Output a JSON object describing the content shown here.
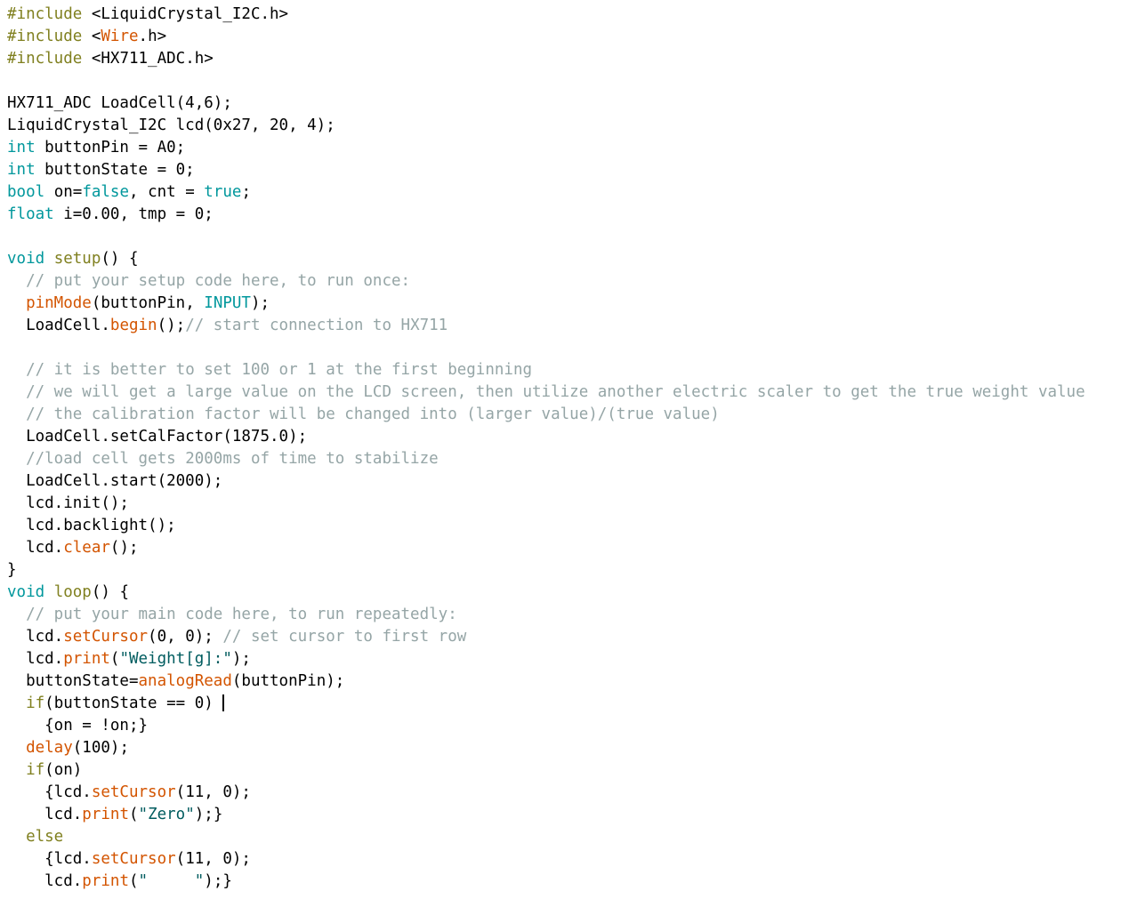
{
  "editor": {
    "language": "arduino-cpp",
    "background_color": "#ffffff",
    "font_size_px": 17.5,
    "line_height_px": 25,
    "caret_visible": true,
    "caret_line_index": 35,
    "colors": {
      "plain": "#000000",
      "keyword": "#00979c",
      "preprocessor": "#808020",
      "function": "#d35400",
      "comment": "#95a5a6",
      "string": "#005c5f"
    }
  },
  "code": {
    "lines": [
      {
        "id": "l1",
        "tokens": [
          {
            "t": "#include",
            "c": "preproc"
          },
          {
            "t": " <LiquidCrystal_I2C.h>",
            "c": "plain"
          }
        ]
      },
      {
        "id": "l2",
        "tokens": [
          {
            "t": "#include",
            "c": "preproc"
          },
          {
            "t": " <",
            "c": "plain"
          },
          {
            "t": "Wire",
            "c": "func"
          },
          {
            "t": ".h>",
            "c": "plain"
          }
        ]
      },
      {
        "id": "l3",
        "tokens": [
          {
            "t": "#include",
            "c": "preproc"
          },
          {
            "t": " <HX711_ADC.h>",
            "c": "plain"
          }
        ]
      },
      {
        "id": "l4",
        "tokens": []
      },
      {
        "id": "l5",
        "tokens": [
          {
            "t": "HX711_ADC LoadCell(4,6);",
            "c": "plain"
          }
        ]
      },
      {
        "id": "l6",
        "tokens": [
          {
            "t": "LiquidCrystal_I2C lcd(0x27, 20, 4);",
            "c": "plain"
          }
        ]
      },
      {
        "id": "l7",
        "tokens": [
          {
            "t": "int",
            "c": "keyword"
          },
          {
            "t": " buttonPin = A0;",
            "c": "plain"
          }
        ]
      },
      {
        "id": "l8",
        "tokens": [
          {
            "t": "int",
            "c": "keyword"
          },
          {
            "t": " buttonState = 0;",
            "c": "plain"
          }
        ]
      },
      {
        "id": "l9",
        "tokens": [
          {
            "t": "bool",
            "c": "keyword"
          },
          {
            "t": " on=",
            "c": "plain"
          },
          {
            "t": "false",
            "c": "keyword"
          },
          {
            "t": ", cnt = ",
            "c": "plain"
          },
          {
            "t": "true",
            "c": "keyword"
          },
          {
            "t": ";",
            "c": "plain"
          }
        ]
      },
      {
        "id": "l10",
        "tokens": [
          {
            "t": "float",
            "c": "keyword"
          },
          {
            "t": " i=0.00, tmp = 0;",
            "c": "plain"
          }
        ]
      },
      {
        "id": "l11",
        "tokens": []
      },
      {
        "id": "l12",
        "tokens": [
          {
            "t": "void",
            "c": "keyword"
          },
          {
            "t": " ",
            "c": "plain"
          },
          {
            "t": "setup",
            "c": "preproc"
          },
          {
            "t": "() {",
            "c": "plain"
          }
        ]
      },
      {
        "id": "l13",
        "tokens": [
          {
            "t": "  ",
            "c": "plain"
          },
          {
            "t": "// put your setup code here, to run once:",
            "c": "comment"
          }
        ]
      },
      {
        "id": "l14",
        "tokens": [
          {
            "t": "  ",
            "c": "plain"
          },
          {
            "t": "pinMode",
            "c": "func"
          },
          {
            "t": "(buttonPin, ",
            "c": "plain"
          },
          {
            "t": "INPUT",
            "c": "keyword"
          },
          {
            "t": ");",
            "c": "plain"
          }
        ]
      },
      {
        "id": "l15",
        "tokens": [
          {
            "t": "  LoadCell.",
            "c": "plain"
          },
          {
            "t": "begin",
            "c": "func"
          },
          {
            "t": "();",
            "c": "plain"
          },
          {
            "t": "// start connection to HX711",
            "c": "comment"
          }
        ]
      },
      {
        "id": "l16",
        "tokens": []
      },
      {
        "id": "l17",
        "tokens": [
          {
            "t": "  ",
            "c": "plain"
          },
          {
            "t": "// it is better to set 100 or 1 at the first beginning",
            "c": "comment"
          }
        ]
      },
      {
        "id": "l18",
        "tokens": [
          {
            "t": "  ",
            "c": "plain"
          },
          {
            "t": "// we will get a large value on the LCD screen, then utilize another electric scaler to get the true weight value",
            "c": "comment"
          }
        ]
      },
      {
        "id": "l19",
        "tokens": [
          {
            "t": "  ",
            "c": "plain"
          },
          {
            "t": "// the calibration factor will be changed into (larger value)/(true value)",
            "c": "comment"
          }
        ]
      },
      {
        "id": "l20",
        "tokens": [
          {
            "t": "  LoadCell.setCalFactor(1875.0);",
            "c": "plain"
          }
        ]
      },
      {
        "id": "l21",
        "tokens": [
          {
            "t": "  ",
            "c": "plain"
          },
          {
            "t": "//load cell gets 2000ms of time to stabilize",
            "c": "comment"
          }
        ]
      },
      {
        "id": "l22",
        "tokens": [
          {
            "t": "  LoadCell.start(2000);",
            "c": "plain"
          }
        ]
      },
      {
        "id": "l23",
        "tokens": [
          {
            "t": "  lcd.init();",
            "c": "plain"
          }
        ]
      },
      {
        "id": "l24",
        "tokens": [
          {
            "t": "  lcd.backlight();",
            "c": "plain"
          }
        ]
      },
      {
        "id": "l25",
        "tokens": [
          {
            "t": "  lcd.",
            "c": "plain"
          },
          {
            "t": "clear",
            "c": "func"
          },
          {
            "t": "();",
            "c": "plain"
          }
        ]
      },
      {
        "id": "l26",
        "tokens": [
          {
            "t": "}",
            "c": "plain"
          }
        ]
      },
      {
        "id": "l27",
        "tokens": [
          {
            "t": "void",
            "c": "keyword"
          },
          {
            "t": " ",
            "c": "plain"
          },
          {
            "t": "loop",
            "c": "preproc"
          },
          {
            "t": "() {",
            "c": "plain"
          }
        ]
      },
      {
        "id": "l28",
        "tokens": [
          {
            "t": "  ",
            "c": "plain"
          },
          {
            "t": "// put your main code here, to run repeatedly:",
            "c": "comment"
          }
        ]
      },
      {
        "id": "l29",
        "tokens": [
          {
            "t": "  lcd.",
            "c": "plain"
          },
          {
            "t": "setCursor",
            "c": "func"
          },
          {
            "t": "(0, 0); ",
            "c": "plain"
          },
          {
            "t": "// set cursor to first row",
            "c": "comment"
          }
        ]
      },
      {
        "id": "l30",
        "tokens": [
          {
            "t": "  lcd.",
            "c": "plain"
          },
          {
            "t": "print",
            "c": "func"
          },
          {
            "t": "(",
            "c": "plain"
          },
          {
            "t": "\"Weight[g]:\"",
            "c": "string"
          },
          {
            "t": ");",
            "c": "plain"
          }
        ]
      },
      {
        "id": "l31",
        "tokens": [
          {
            "t": "  buttonState=",
            "c": "plain"
          },
          {
            "t": "analogRead",
            "c": "func"
          },
          {
            "t": "(buttonPin);",
            "c": "plain"
          }
        ]
      },
      {
        "id": "l32",
        "tokens": [
          {
            "t": "  ",
            "c": "plain"
          },
          {
            "t": "if",
            "c": "preproc"
          },
          {
            "t": "(buttonState == 0) ",
            "c": "plain"
          }
        ],
        "caret": true
      },
      {
        "id": "l33",
        "tokens": [
          {
            "t": "    {on = !on;}",
            "c": "plain"
          }
        ]
      },
      {
        "id": "l34",
        "tokens": [
          {
            "t": "  ",
            "c": "plain"
          },
          {
            "t": "delay",
            "c": "func"
          },
          {
            "t": "(100);",
            "c": "plain"
          }
        ]
      },
      {
        "id": "l35",
        "tokens": [
          {
            "t": "  ",
            "c": "plain"
          },
          {
            "t": "if",
            "c": "preproc"
          },
          {
            "t": "(on)",
            "c": "plain"
          }
        ]
      },
      {
        "id": "l36",
        "tokens": [
          {
            "t": "    {lcd.",
            "c": "plain"
          },
          {
            "t": "setCursor",
            "c": "func"
          },
          {
            "t": "(11, 0);",
            "c": "plain"
          }
        ]
      },
      {
        "id": "l37",
        "tokens": [
          {
            "t": "    lcd.",
            "c": "plain"
          },
          {
            "t": "print",
            "c": "func"
          },
          {
            "t": "(",
            "c": "plain"
          },
          {
            "t": "\"Zero\"",
            "c": "string"
          },
          {
            "t": ");}",
            "c": "plain"
          }
        ]
      },
      {
        "id": "l38",
        "tokens": [
          {
            "t": "  ",
            "c": "plain"
          },
          {
            "t": "else",
            "c": "preproc"
          }
        ]
      },
      {
        "id": "l39",
        "tokens": [
          {
            "t": "    {lcd.",
            "c": "plain"
          },
          {
            "t": "setCursor",
            "c": "func"
          },
          {
            "t": "(11, 0);",
            "c": "plain"
          }
        ]
      },
      {
        "id": "l40",
        "tokens": [
          {
            "t": "    lcd.",
            "c": "plain"
          },
          {
            "t": "print",
            "c": "func"
          },
          {
            "t": "(",
            "c": "plain"
          },
          {
            "t": "\"     \"",
            "c": "string"
          },
          {
            "t": ");}",
            "c": "plain"
          }
        ]
      }
    ]
  }
}
